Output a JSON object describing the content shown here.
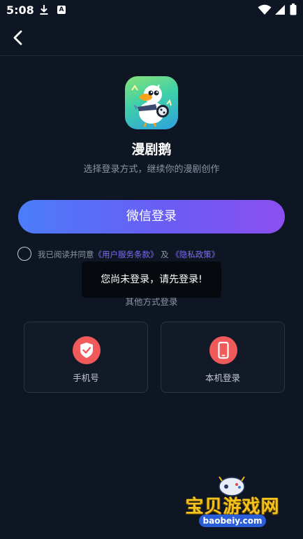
{
  "status_bar": {
    "time": "5:08",
    "download_icon": "download-icon",
    "a_badge": "A",
    "wifi_icon": "wifi-icon",
    "signal_icon": "signal-icon",
    "battery_icon": "battery-icon"
  },
  "nav": {
    "back_icon": "chevron-left-icon"
  },
  "app": {
    "logo_icon": "duck-mascot-logo",
    "name": "漫剧鹅",
    "subtitle": "选择登录方式，继续你的漫剧创作"
  },
  "login": {
    "wechat_label": "微信登录"
  },
  "agreement": {
    "prefix": "我已阅读并同意",
    "terms_link": "《用户服务条款》",
    "joiner": "及",
    "privacy_link": "《隐私政策》",
    "checked": false
  },
  "other_methods": {
    "title": "其他方式登录",
    "methods": [
      {
        "label": "手机号",
        "icon": "shield-check-icon"
      },
      {
        "label": "本机登录",
        "icon": "mobile-phone-icon"
      }
    ]
  },
  "toast": {
    "message": "您尚未登录，请先登录!"
  },
  "watermark": {
    "title": "宝贝游戏网",
    "domain": "baobeiy.com"
  },
  "colors": {
    "background": "#0f1623",
    "button_gradient_start": "#4b7dfb",
    "button_gradient_end": "#8b4ff1",
    "link": "#7e6cf6",
    "method_icon_bg": "#f05a5a"
  }
}
